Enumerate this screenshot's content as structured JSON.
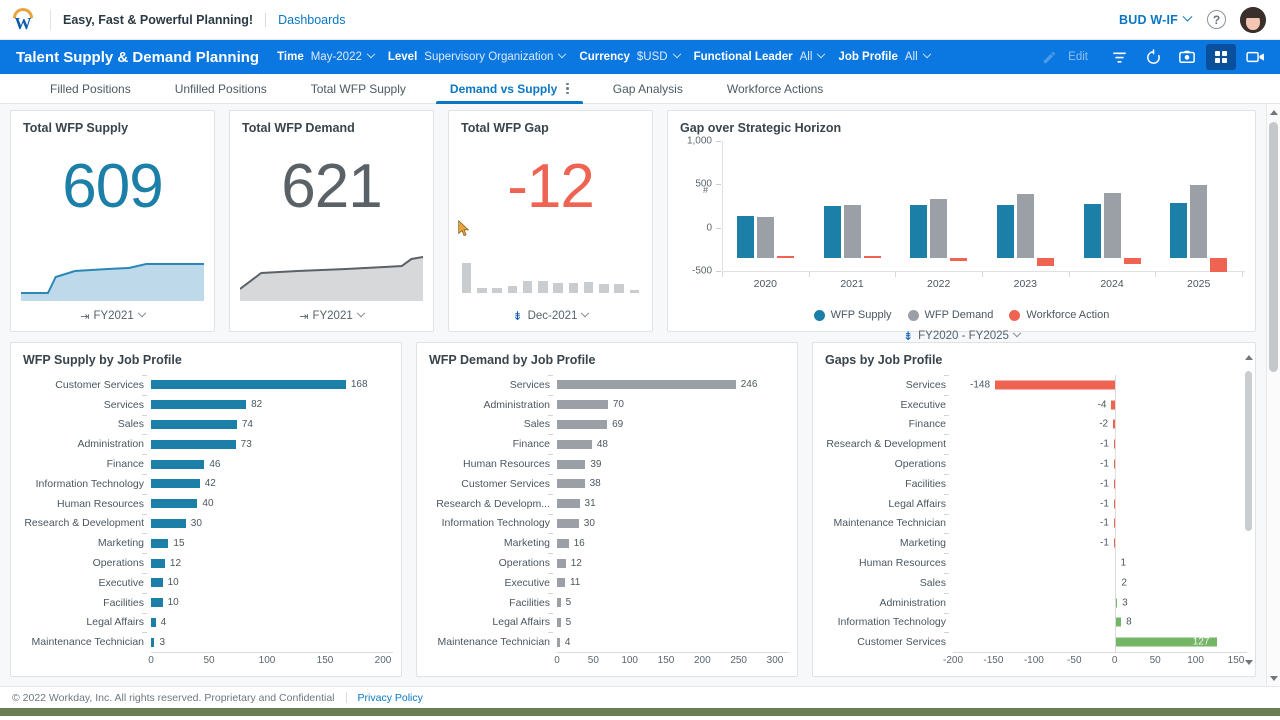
{
  "topbar": {
    "logo_name": "workday-logo",
    "tagline": "Easy, Fast & Powerful Planning!",
    "breadcrumb": "Dashboards",
    "tenant": "BUD W-IF",
    "help_glyph": "?"
  },
  "header": {
    "title": "Talent Supply & Demand Planning",
    "filters": [
      {
        "label": "Time",
        "value": "May-2022"
      },
      {
        "label": "Level",
        "value": "Supervisory Organization"
      },
      {
        "label": "Currency",
        "value": "$USD"
      },
      {
        "label": "Functional Leader",
        "value": "All"
      },
      {
        "label": "Job Profile",
        "value": "All"
      }
    ],
    "edit_label": "Edit",
    "tools": [
      "pencil-icon",
      "filter-icon",
      "refresh-icon",
      "camera-icon",
      "grid-icon",
      "presentation-icon"
    ]
  },
  "tabs": [
    {
      "label": "Filled Positions",
      "selected": false
    },
    {
      "label": "Unfilled Positions",
      "selected": false
    },
    {
      "label": "Total WFP Supply",
      "selected": false
    },
    {
      "label": "Demand vs Supply",
      "selected": true
    },
    {
      "label": "Gap Analysis",
      "selected": false
    },
    {
      "label": "Workforce Actions",
      "selected": false
    }
  ],
  "kpis": [
    {
      "title": "Total WFP Supply",
      "value": "609",
      "color": "#1b7fa8",
      "footer": "FY2021",
      "footer_icon": "trend-icon"
    },
    {
      "title": "Total WFP Demand",
      "value": "621",
      "color": "#5a6167",
      "footer": "FY2021",
      "footer_icon": "trend-icon"
    },
    {
      "title": "Total WFP Gap",
      "value": "-12",
      "color": "#ee6352",
      "footer": "Dec-2021",
      "footer_icon": "pin-icon"
    }
  ],
  "footer": {
    "copyright": "© 2022 Workday, Inc. All rights reserved. Proprietary and Confidential",
    "privacy": "Privacy Policy"
  },
  "chart_data": [
    {
      "id": "gap-over-strategic-horizon",
      "type": "bar",
      "title": "Gap over Strategic Horizon",
      "subtitle": "FY2020 - FY2025",
      "xlabel": "",
      "ylabel": "#",
      "categories": [
        "2020",
        "2021",
        "2022",
        "2023",
        "2024",
        "2025"
      ],
      "series": [
        {
          "name": "WFP Supply",
          "color": "#1b7fa8",
          "values": [
            478,
            596,
            608,
            607,
            618,
            630
          ]
        },
        {
          "name": "WFP Demand",
          "color": "#9aa0a6",
          "values": [
            470,
            605,
            675,
            740,
            752,
            840
          ]
        },
        {
          "name": "Workforce Action",
          "color": "#ee6352",
          "values": [
            12,
            -8,
            -42,
            -92,
            -72,
            -160
          ]
        }
      ],
      "ylim": [
        -500,
        1000
      ],
      "yticks": [
        -500,
        0,
        500,
        1000
      ],
      "ytick_labels": [
        "-500",
        "0",
        "500",
        "1,000"
      ],
      "legend_position": "bottom",
      "grid": false
    },
    {
      "id": "wfp-supply-by-job-profile",
      "type": "bar",
      "orientation": "horizontal",
      "title": "WFP Supply by Job Profile",
      "color": "#1b7fa8",
      "categories": [
        "Customer Services",
        "Services",
        "Sales",
        "Administration",
        "Finance",
        "Information Technology",
        "Human Resources",
        "Research & Development",
        "Marketing",
        "Operations",
        "Executive",
        "Facilities",
        "Legal Affairs",
        "Maintenance Technician"
      ],
      "values": [
        168,
        82,
        74,
        73,
        46,
        42,
        40,
        30,
        15,
        12,
        10,
        10,
        4,
        3
      ],
      "xlim": [
        0,
        200
      ],
      "xticks": [
        0,
        50,
        100,
        150,
        200
      ],
      "grid": false
    },
    {
      "id": "wfp-demand-by-job-profile",
      "type": "bar",
      "orientation": "horizontal",
      "title": "WFP Demand by Job Profile",
      "color": "#9aa0a6",
      "categories": [
        "Services",
        "Administration",
        "Sales",
        "Finance",
        "Human Resources",
        "Customer Services",
        "Research & Developm...",
        "Information Technology",
        "Marketing",
        "Operations",
        "Executive",
        "Facilities",
        "Legal Affairs",
        "Maintenance Technician"
      ],
      "values": [
        246,
        70,
        69,
        48,
        39,
        38,
        31,
        30,
        16,
        12,
        11,
        5,
        5,
        4
      ],
      "xlim": [
        0,
        300
      ],
      "xticks": [
        0,
        50,
        100,
        150,
        200,
        250,
        300
      ],
      "grid": false
    },
    {
      "id": "gaps-by-job-profile",
      "type": "bar",
      "orientation": "horizontal",
      "title": "Gaps by Job Profile",
      "neg_color": "#ee6352",
      "pos_color": "#74b566",
      "categories": [
        "Services",
        "Executive",
        "Finance",
        "Research & Development",
        "Operations",
        "Facilities",
        "Legal Affairs",
        "Maintenance Technician",
        "Marketing",
        "Human Resources",
        "Sales",
        "Administration",
        "Information Technology",
        "Customer Services"
      ],
      "values": [
        -148,
        -4,
        -2,
        -1,
        -1,
        -1,
        -1,
        -1,
        -1,
        1,
        2,
        3,
        8,
        127
      ],
      "xlim": [
        -200,
        150
      ],
      "xticks": [
        -200,
        -150,
        -100,
        -50,
        0,
        50,
        100,
        150
      ],
      "grid": false
    }
  ],
  "sparklines": {
    "supply": {
      "color": "#2b87b5",
      "fill": "#bdd9ea",
      "points": [
        18,
        18,
        18,
        18,
        12,
        6,
        5,
        5,
        4.5,
        4,
        4,
        3.5,
        3,
        3,
        2.5,
        2.5,
        2,
        2,
        2,
        2
      ]
    },
    "demand": {
      "color": "#5a6167",
      "fill": "#d6d8da",
      "points": [
        26,
        16,
        15,
        14.5,
        14,
        13.5,
        13,
        12.5,
        12,
        11.5,
        11,
        10.5,
        10,
        9.5,
        9,
        8.5,
        8,
        7.5,
        7,
        2
      ]
    },
    "gap": {
      "color": "#c9cdd0",
      "bars": [
        30,
        5,
        5,
        7,
        12,
        12,
        10,
        10,
        11,
        9,
        9,
        3
      ]
    }
  }
}
